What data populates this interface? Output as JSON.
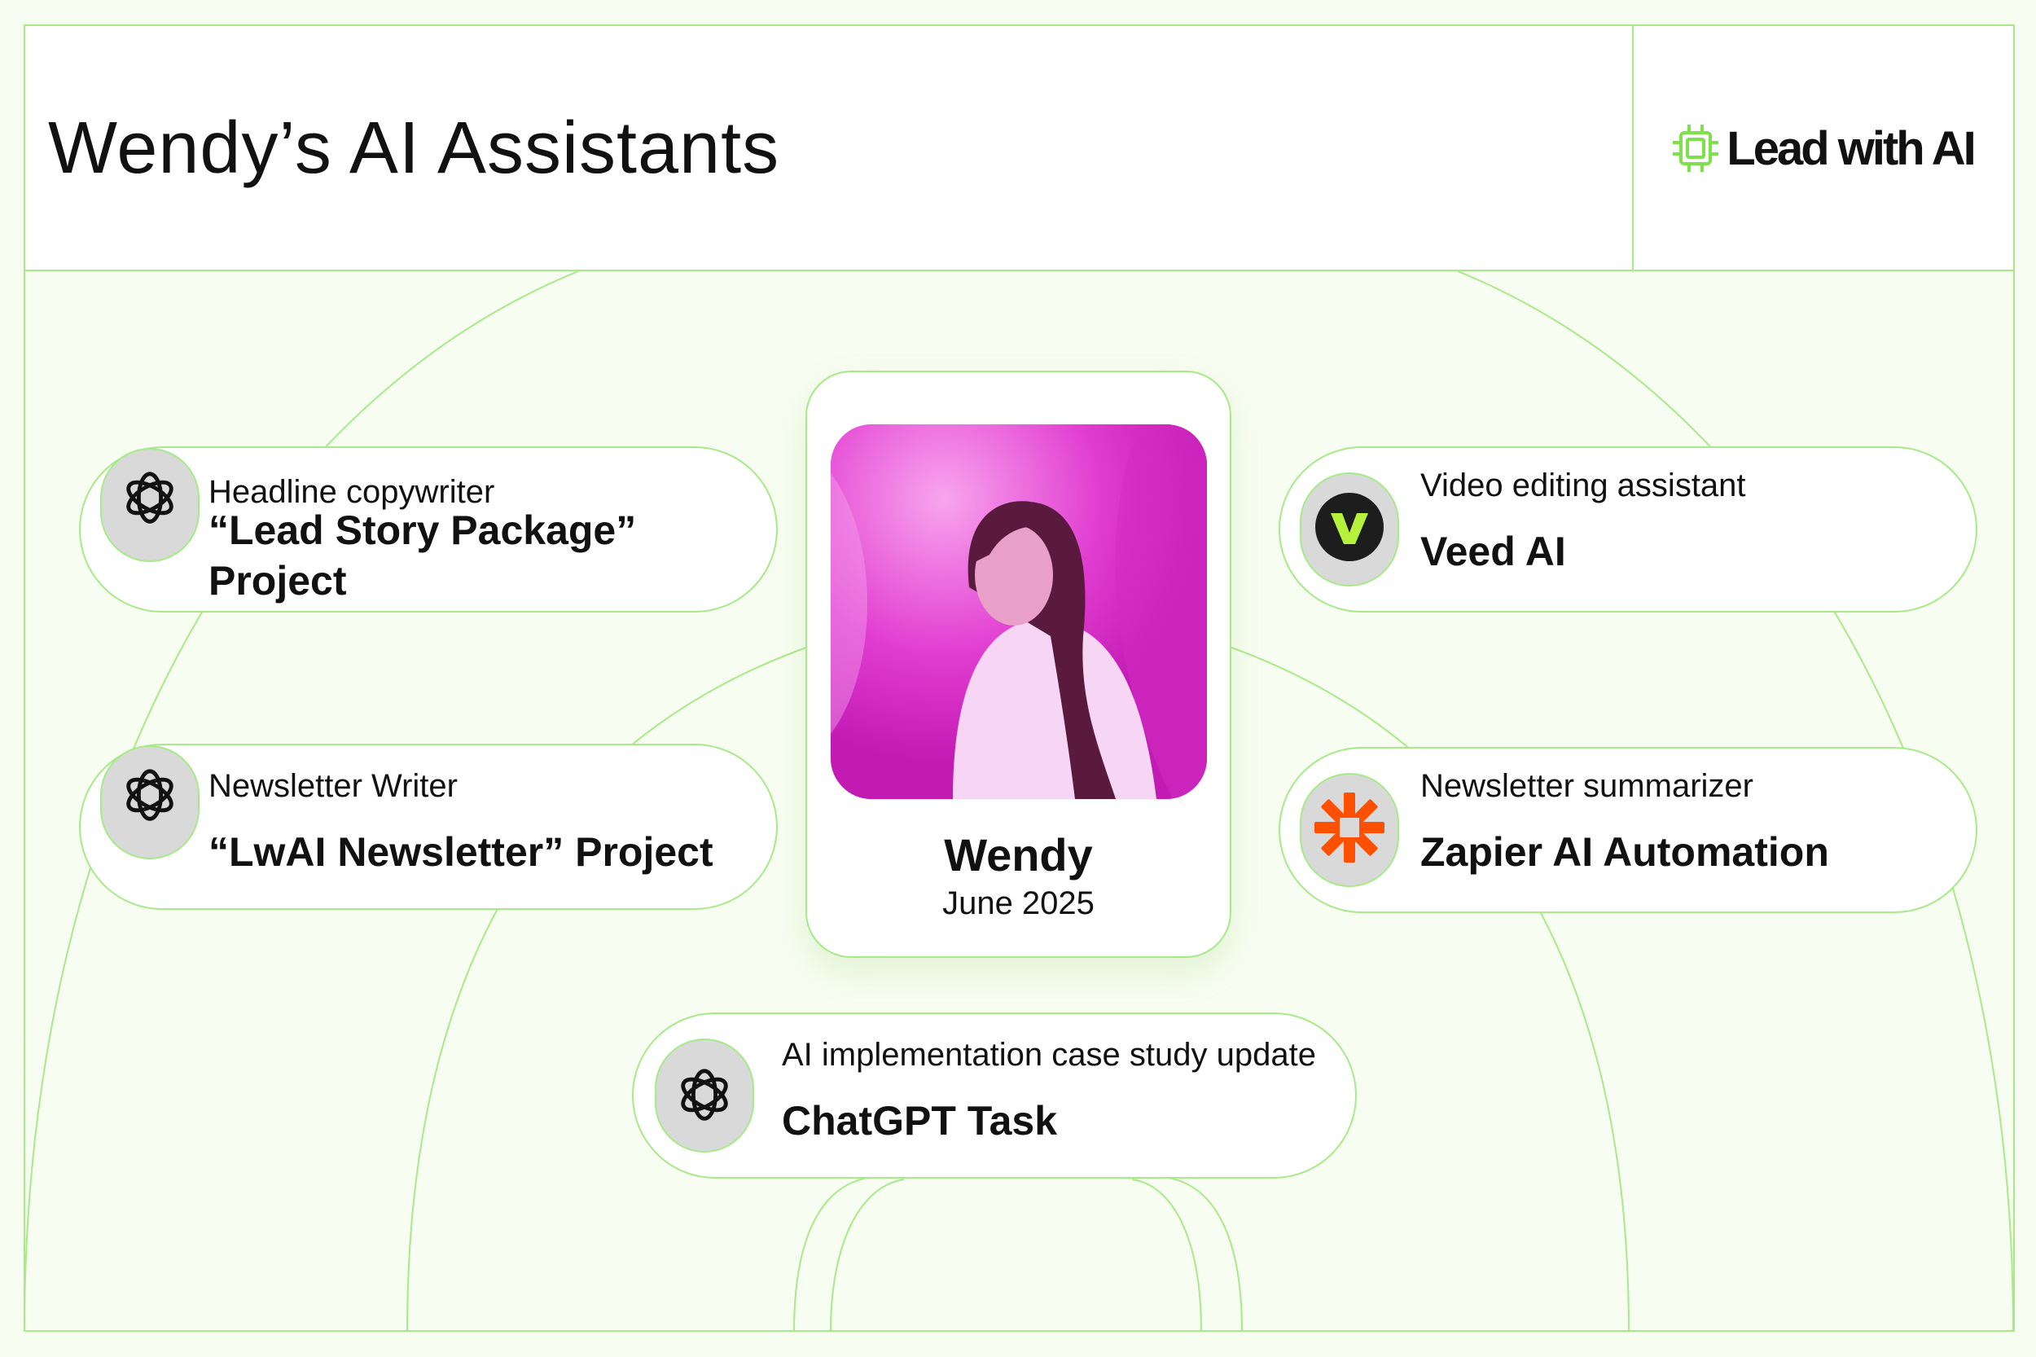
{
  "header": {
    "title": "Wendy’s AI Assistants",
    "logo_text": "Lead with AI"
  },
  "profile": {
    "name": "Wendy",
    "date": "June 2025"
  },
  "assistants": [
    {
      "subtitle": "Headline copywriter",
      "title_line1": "“Lead Story Package”",
      "title_line2": "Project",
      "icon": "openai-icon"
    },
    {
      "subtitle": "Newsletter Writer",
      "title": "“LwAI Newsletter” Project",
      "icon": "openai-icon"
    },
    {
      "subtitle": "Video editing assistant",
      "title": "Veed AI",
      "icon": "veed-icon"
    },
    {
      "subtitle": "Newsletter summarizer",
      "title": "Zapier AI Automation",
      "icon": "zapier-icon"
    },
    {
      "subtitle": "AI implementation case study update",
      "title": "ChatGPT Task",
      "icon": "openai-icon"
    }
  ],
  "colors": {
    "background": "#f8fdf1",
    "accent_green": "#a8e98a",
    "logo_green": "#7ee04a",
    "veed_green": "#b6f23c",
    "zapier_orange": "#ff4f00",
    "photo_magenta": "#e23ad0"
  }
}
